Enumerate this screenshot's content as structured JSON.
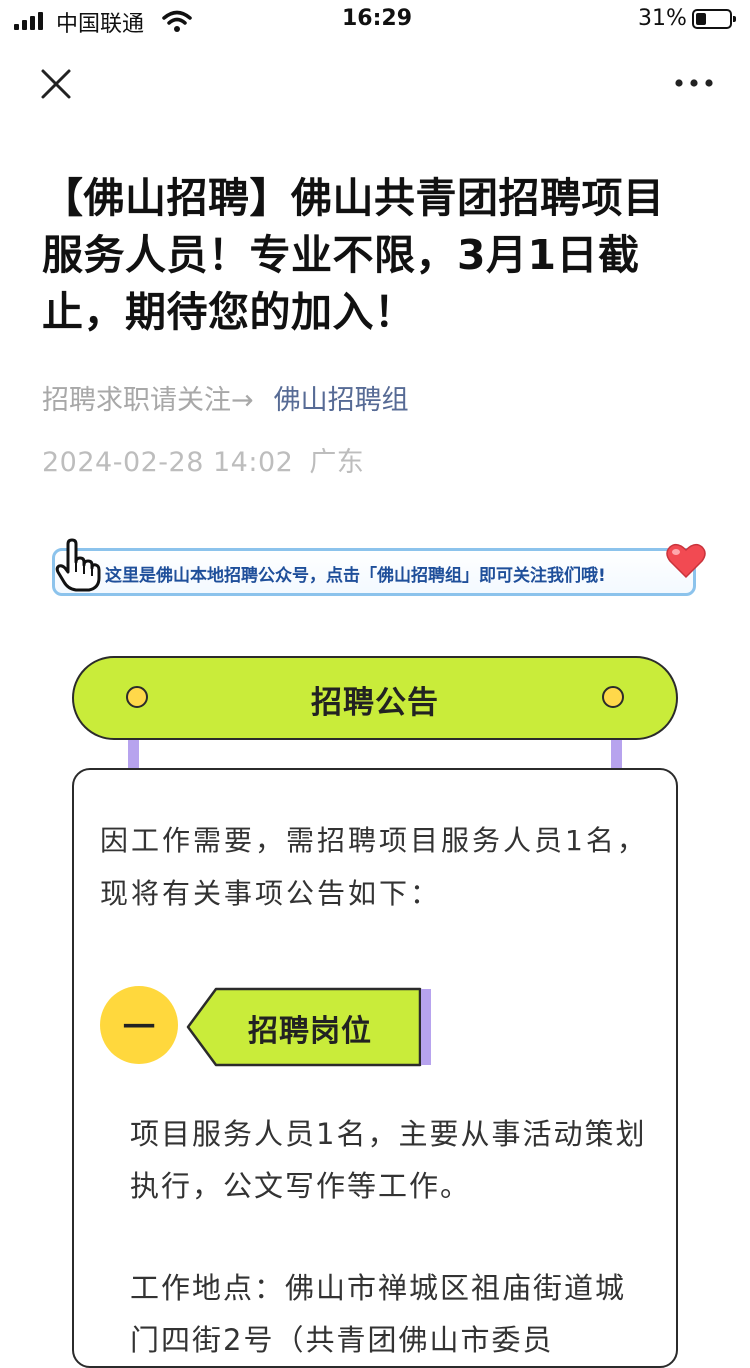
{
  "status_bar": {
    "carrier": "中国联通",
    "time": "16:29",
    "battery": "31%",
    "battery_level": 0.31
  },
  "nav": {
    "close_icon": "close-icon",
    "more_icon": "more-icon"
  },
  "article": {
    "title": "【佛山招聘】佛山共青团招聘项目服务人员！专业不限，3月1日截止，期待您的加入！",
    "follow_hint": "招聘求职请关注→",
    "account_name": "佛山招聘组",
    "date": "2024-02-28 14:02",
    "location": "广东"
  },
  "banner": {
    "text": "这里是佛山本地招聘公众号，点击「佛山招聘组」即可关注我们哦!",
    "border_color": "#8cc3ec",
    "text_color": "#1f4f9a"
  },
  "notice": {
    "header": "招聘公告",
    "accent_color": "#c9ec3a",
    "dot_color": "#ffd84a",
    "post_color": "#b7a3ee",
    "intro": "因工作需要，需招聘项目服务人员1名，现将有关事项公告如下："
  },
  "section1": {
    "number": "一",
    "title": "招聘岗位",
    "job_desc": "项目服务人员1名，主要从事活动策划执行，公文写作等工作。",
    "work_location": "工作地点：佛山市禅城区祖庙街道城门四街2号（共青团佛山市委员"
  }
}
